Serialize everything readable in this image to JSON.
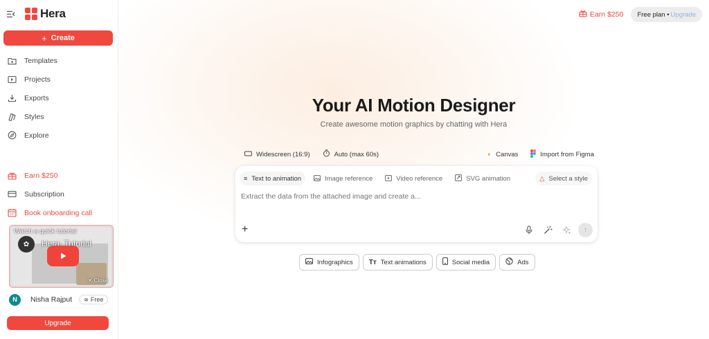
{
  "app": {
    "name": "Hera"
  },
  "sidebar": {
    "create_label": "Create",
    "nav": [
      {
        "label": "Templates",
        "icon": "templates-icon"
      },
      {
        "label": "Projects",
        "icon": "projects-icon"
      },
      {
        "label": "Exports",
        "icon": "download-icon"
      },
      {
        "label": "Styles",
        "icon": "styles-icon"
      },
      {
        "label": "Explore",
        "icon": "compass-icon"
      }
    ],
    "secondary": [
      {
        "label": "Earn $250",
        "icon": "gift-icon"
      },
      {
        "label": "Subscription",
        "icon": "card-icon"
      },
      {
        "label": "Book onboarding call",
        "icon": "calendar-icon"
      }
    ],
    "tutorial": {
      "heading": "Watch a quick tutorial",
      "video_title": "Hera: Tutorial",
      "close_label": "Close"
    },
    "user": {
      "initial": "N",
      "name": "Nisha Rajput",
      "plan": "Free"
    },
    "upgrade_label": "Upgrade"
  },
  "header": {
    "earn_label": "Earn $250",
    "plan_label": "Free plan •",
    "upgrade_link": "Upgrade"
  },
  "hero": {
    "title": "Your AI Motion Designer",
    "subtitle": "Create awesome motion graphics by chatting with Hera"
  },
  "options": {
    "aspect": "Widescreen (16:9)",
    "duration": "Auto (max 60s)",
    "canvas": "Canvas",
    "import": "Import from Figma"
  },
  "prompt": {
    "modes": [
      {
        "label": "Text to animation",
        "active": true
      },
      {
        "label": "Image reference",
        "active": false
      },
      {
        "label": "Video reference",
        "active": false
      },
      {
        "label": "SVG animation",
        "active": false
      }
    ],
    "style_label": "Select a style",
    "placeholder": "Extract the data from the attached image and create a..."
  },
  "chips": [
    {
      "label": "Infographics",
      "icon": "image-icon"
    },
    {
      "label": "Text animations",
      "icon": "text-icon"
    },
    {
      "label": "Social media",
      "icon": "phone-icon"
    },
    {
      "label": "Ads",
      "icon": "globe-icon"
    }
  ],
  "colors": {
    "accent": "#f0483e"
  }
}
